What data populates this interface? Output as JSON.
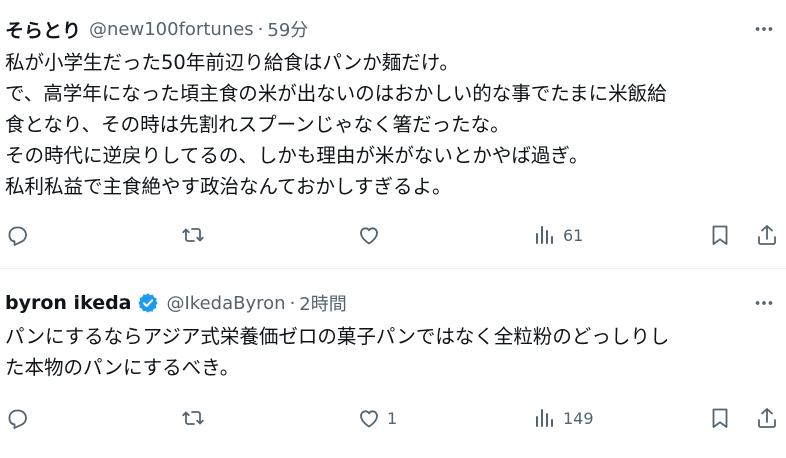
{
  "tweets": [
    {
      "name": "そらとり",
      "handle": "@new100fortunes",
      "separator": "·",
      "time": "59分",
      "verified": false,
      "lines": [
        "私が小学生だった50年前辺り給食はパンか麺だけ。",
        "で、高学年になった頃主食の米が出ないのはおかしい的な事でたまに米飯給",
        "食となり、その時は先割れスプーンじゃなく箸だったな。",
        "その時代に逆戻りしてるの、しかも理由が米がないとかやば過ぎ。",
        "私利私益で主食絶やす政治なんておかしすぎるよ。"
      ],
      "actions": {
        "reply_count": "",
        "retweet_count": "",
        "like_count": "",
        "views_count": "61"
      }
    },
    {
      "name": "byron ikeda",
      "handle": "@IkedaByron",
      "separator": "·",
      "time": "2時間",
      "verified": true,
      "lines": [
        "パンにするならアジア式栄養価ゼロの菓子パンではなく全粒粉のどっしりし",
        "た本物のパンにするべき。"
      ],
      "actions": {
        "reply_count": "",
        "retweet_count": "",
        "like_count": "1",
        "views_count": "149"
      }
    }
  ],
  "colors": {
    "text": "#0f1419",
    "secondary": "#536471",
    "verified": "#1d9bf0",
    "divider": "#eff3f4"
  },
  "icons": [
    "reply-icon",
    "retweet-icon",
    "like-icon",
    "views-icon",
    "bookmark-icon",
    "share-icon",
    "more-icon",
    "verified-badge-icon"
  ]
}
